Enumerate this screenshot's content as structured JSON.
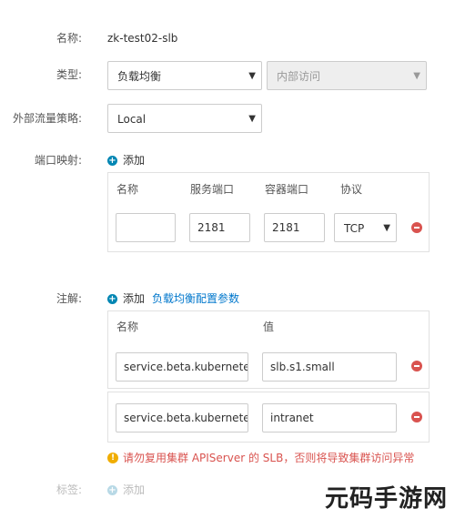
{
  "form": {
    "name": {
      "label": "名称:",
      "value": "zk-test02-slb"
    },
    "type": {
      "label": "类型:",
      "selected": "负载均衡",
      "sub_selected": "内部访问"
    },
    "traffic_policy": {
      "label": "外部流量策略:",
      "selected": "Local"
    },
    "port_mapping": {
      "label": "端口映射:",
      "add_label": "添加",
      "headers": [
        "名称",
        "服务端口",
        "容器端口",
        "协议"
      ],
      "rows": [
        {
          "name": "",
          "service_port": "2181",
          "container_port": "2181",
          "protocol": "TCP"
        }
      ]
    },
    "annotations": {
      "label": "注解:",
      "add_label": "添加",
      "link_label": "负载均衡配置参数",
      "headers": [
        "名称",
        "值"
      ],
      "rows": [
        {
          "name": "service.beta.kubernetes.io",
          "value": "slb.s1.small"
        },
        {
          "name": "service.beta.kubernetes.io",
          "value": "intranet"
        }
      ],
      "warning": "请勿复用集群 APIServer 的 SLB，否则将导致集群访问异常"
    },
    "tags": {
      "label": "标签:",
      "add_label": "添加"
    }
  },
  "icons": {
    "add": "plus-circle-icon",
    "remove": "minus-circle-icon",
    "warning": "exclamation-circle-icon",
    "dropdown": "caret-down-icon"
  },
  "watermark": "元码手游网",
  "colors": {
    "accent": "#0086b3",
    "danger": "#d9534f",
    "warning": "#f0ad00",
    "link": "#0077cc"
  }
}
